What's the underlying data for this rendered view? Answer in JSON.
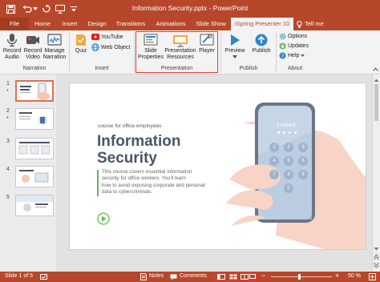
{
  "window": {
    "title": "Information Security.pptx - PowerPoint"
  },
  "tabs": {
    "file": "File",
    "home": "Home",
    "insert": "Insert",
    "design": "Design",
    "transitions": "Transitions",
    "animations": "Animations",
    "slide_show": "Slide Show",
    "ispring": "iSpring Presenter 10",
    "tell_me": "Tell me"
  },
  "ribbon": {
    "record_audio": [
      "Record",
      "Audio"
    ],
    "record_video": [
      "Record",
      "Video"
    ],
    "manage_narration": [
      "Manage",
      "Narration"
    ],
    "narration_group": "Narration",
    "quiz": "Quiz",
    "youtube": "YouTube",
    "web_object": "Web Object",
    "insert_group": "Insert",
    "slide_properties": [
      "Slide",
      "Properties"
    ],
    "presentation_resources": [
      "Presentation",
      "Resources"
    ],
    "player": "Player",
    "presentation_group": "Presentation",
    "preview": "Preview",
    "publish": "Publish",
    "publish_group": "Publish",
    "options": "Options",
    "updates": "Updates",
    "help": "Help",
    "about_group": "About"
  },
  "thumbnails": [
    {
      "num": "1",
      "star": "*"
    },
    {
      "num": "2",
      "star": "*"
    },
    {
      "num": "3",
      "star": ""
    },
    {
      "num": "4",
      "star": ""
    },
    {
      "num": "5",
      "star": ""
    }
  ],
  "slide": {
    "subtitle": "course for office employees",
    "title_line1": "Information",
    "title_line2": "Security",
    "body": [
      "This course covers essential information",
      "security for office workers. You'll learn",
      "how to avoid exposing corporate and personal",
      "data to cybercriminals."
    ],
    "phone_locked": "Locked",
    "keypad": [
      "1",
      "2",
      "3",
      "4",
      "5",
      "6",
      "7",
      "8",
      "9",
      "0"
    ]
  },
  "statusbar": {
    "slide_info": "Slide 1 of 5",
    "notes": "Notes",
    "comments": "Comments",
    "zoom": "50 %"
  },
  "colors": {
    "accent": "#b7472a",
    "slide_green": "#5dbf4e",
    "slide_title": "#4a5566"
  }
}
